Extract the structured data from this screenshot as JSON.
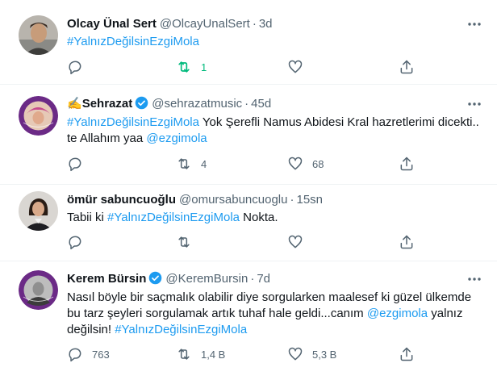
{
  "tweets": [
    {
      "name": "Olcay Ünal Sert",
      "handle": "@OlcayUnalSert",
      "dot": "·",
      "time": "3d",
      "text_parts": [
        {
          "text": "#YalnızDeğilsinEzgiMola",
          "link": true
        }
      ],
      "reply_count": "",
      "retweet_count": "1",
      "like_count": "",
      "retweeted": true,
      "verified": false,
      "avatar_icon": "person-photo"
    },
    {
      "name_emoji": "✍️",
      "name": "Sehrazat",
      "handle": "@sehrazatmusic",
      "dot": "·",
      "time": "45d",
      "text_parts": [
        {
          "text": "#YalnızDeğilsinEzgiMola",
          "link": true
        },
        {
          "text": " Yok Şerefli Namus Abidesi Kral hazretlerimi dicekti.. te Allahım yaa ",
          "link": false
        },
        {
          "text": "@ezgimola",
          "link": true
        }
      ],
      "reply_count": "",
      "retweet_count": "4",
      "like_count": "68",
      "retweeted": false,
      "verified": true,
      "avatar_icon": "round-badge-photo"
    },
    {
      "name": "ömür sabuncuoğlu",
      "handle": "@omursabuncuoglu",
      "dot": "·",
      "time": "15sn",
      "text_parts": [
        {
          "text": "Tabii ki ",
          "link": false
        },
        {
          "text": "#YalnızDeğilsinEzgiMola",
          "link": true
        },
        {
          "text": " Nokta.",
          "link": false
        }
      ],
      "reply_count": "",
      "retweet_count": "",
      "like_count": "",
      "retweeted": false,
      "verified": false,
      "avatar_icon": "person-photo"
    },
    {
      "name": "Kerem Bürsin",
      "handle": "@KeremBursin",
      "dot": "·",
      "time": "7d",
      "text_parts": [
        {
          "text": "Nasıl böyle bir saçmalık olabilir diye sorgularken maalesef ki güzel ülkemde bu tarz şeyleri sorgulamak artık tuhaf hale geldi...canım ",
          "link": false
        },
        {
          "text": "@ezgimola",
          "link": true
        },
        {
          "text": " yalnız değilsin! ",
          "link": false
        },
        {
          "text": "#YalnızDeğilsinEzgiMola",
          "link": true
        }
      ],
      "reply_count": "763",
      "retweet_count": "1,4 B",
      "like_count": "5,3 B",
      "retweeted": false,
      "verified": true,
      "avatar_icon": "round-badge-photo"
    }
  ],
  "colors": {
    "link": "#1d9bf0",
    "muted": "#536471",
    "retweet_active": "#00ba7c",
    "divider": "#eff3f4",
    "verified": "#1d9bf0"
  }
}
